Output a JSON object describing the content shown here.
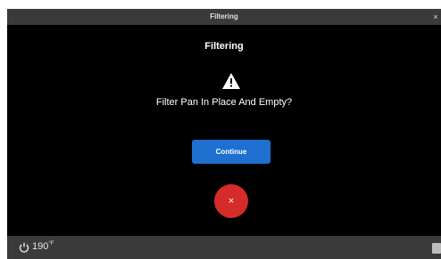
{
  "window": {
    "title": "Filtering",
    "close_glyph": "×"
  },
  "dialog": {
    "title": "Filtering",
    "icon": "warning-icon",
    "question": "Filter Pan In Place And Empty?",
    "continue_label": "Continue",
    "cancel_glyph": "×"
  },
  "status_bar": {
    "temperature": "190",
    "unit": "°F",
    "left_icon": "power-icon",
    "right_icon": "settings-icon"
  },
  "colors": {
    "background": "#000000",
    "bar": "#3a3a3a",
    "continue_button": "#1e6fd0",
    "cancel_button": "#d52b2b"
  }
}
